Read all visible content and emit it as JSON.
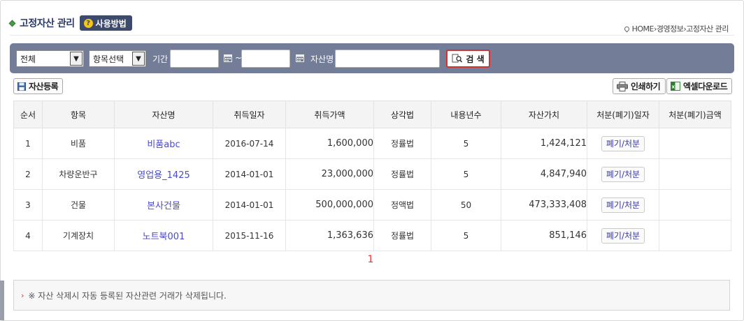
{
  "header": {
    "title": "고정자산 관리",
    "help_label": "사용방법",
    "breadcrumb": [
      "HOME",
      "경영정보",
      "고정자산 관리"
    ]
  },
  "search": {
    "category_select": "전체",
    "item_select": "항목선택",
    "period_label": "기간 :",
    "tilde": "~",
    "asset_name_label": "자산명 :",
    "start_date": "",
    "end_date": "",
    "asset_name": "",
    "search_label": "검 색"
  },
  "toolbar": {
    "register_label": "자산등록",
    "print_label": "인쇄하기",
    "excel_label": "엑셀다운로드"
  },
  "table": {
    "headers": [
      "순서",
      "항목",
      "자산명",
      "취득일자",
      "취득가액",
      "상각법",
      "내용년수",
      "자산가치",
      "처분(폐기)일자",
      "처분(폐기)금액"
    ],
    "rows": [
      {
        "no": "1",
        "item": "비품",
        "name": "비품abc",
        "date": "2016-07-14",
        "cost": "1,600,000",
        "method": "정률법",
        "life": "5",
        "value": "1,424,121",
        "dispose": "폐기/처분",
        "disposal_amount": ""
      },
      {
        "no": "2",
        "item": "차량운반구",
        "name": "영업용_1425",
        "date": "2014-01-01",
        "cost": "23,000,000",
        "method": "정률법",
        "life": "5",
        "value": "4,847,940",
        "dispose": "폐기/처분",
        "disposal_amount": ""
      },
      {
        "no": "3",
        "item": "건물",
        "name": "본사건물",
        "date": "2014-01-01",
        "cost": "500,000,000",
        "method": "정액법",
        "life": "50",
        "value": "473,333,408",
        "dispose": "폐기/처분",
        "disposal_amount": ""
      },
      {
        "no": "4",
        "item": "기계장치",
        "name": "노트북001",
        "date": "2015-11-16",
        "cost": "1,363,636",
        "method": "정률법",
        "life": "5",
        "value": "851,146",
        "dispose": "폐기/처분",
        "disposal_amount": ""
      }
    ]
  },
  "pagination": {
    "current": "1"
  },
  "notice": {
    "text": "※ 자산 삭제시 자동 등록된 자산관련 거래가 삭제됩니다."
  },
  "colors": {
    "search_bar": "#737d98",
    "title": "#2b3a6b",
    "accent_red": "#cc3333",
    "link": "#4a4acb"
  }
}
